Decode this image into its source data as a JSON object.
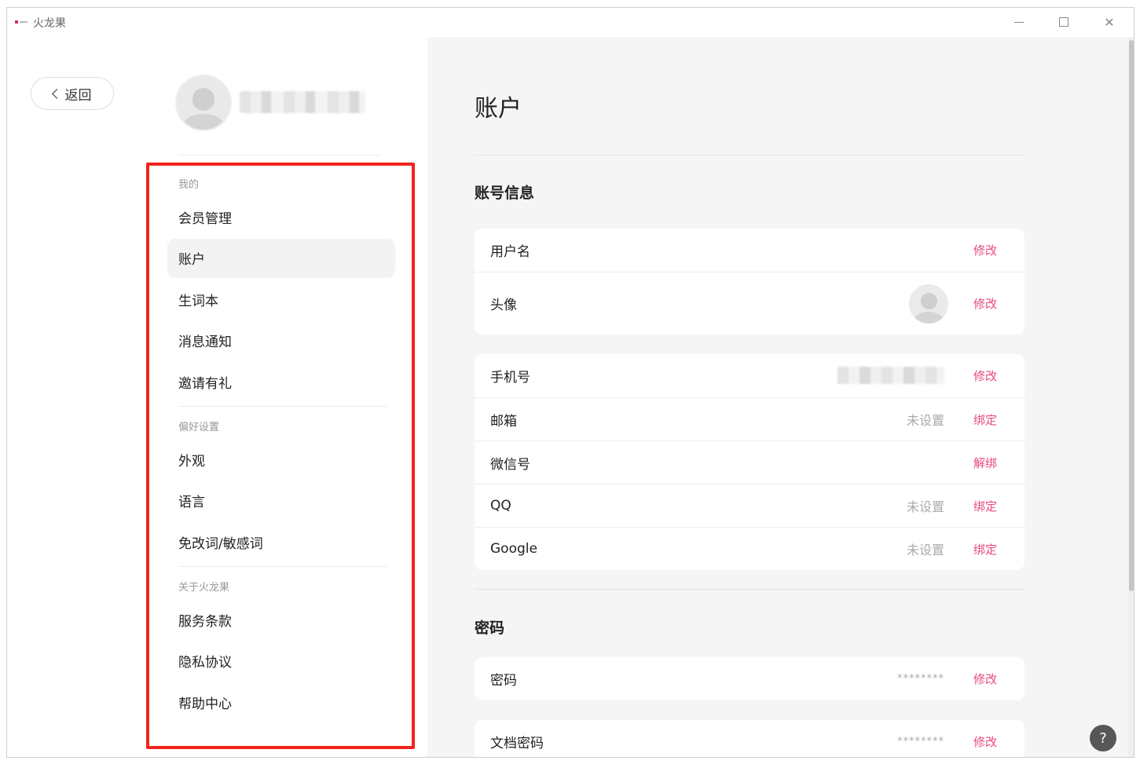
{
  "window": {
    "app_title": "火龙果",
    "close_glyph": "✕"
  },
  "sidebar": {
    "back_label": "返回",
    "sections": [
      {
        "title": "我的",
        "items": [
          {
            "label": "会员管理",
            "active": false
          },
          {
            "label": "账户",
            "active": true
          },
          {
            "label": "生词本",
            "active": false
          },
          {
            "label": "消息通知",
            "active": false
          },
          {
            "label": "邀请有礼",
            "active": false
          }
        ]
      },
      {
        "title": "偏好设置",
        "items": [
          {
            "label": "外观",
            "active": false
          },
          {
            "label": "语言",
            "active": false
          },
          {
            "label": "免改词/敏感词",
            "active": false
          }
        ]
      },
      {
        "title": "关于火龙果",
        "items": [
          {
            "label": "服务条款",
            "active": false
          },
          {
            "label": "隐私协议",
            "active": false
          },
          {
            "label": "帮助中心",
            "active": false
          }
        ]
      }
    ]
  },
  "main": {
    "page_title": "账户",
    "account_info": {
      "title": "账号信息",
      "profile_card": {
        "username": {
          "label": "用户名",
          "action": "修改"
        },
        "avatar": {
          "label": "头像",
          "action": "修改"
        }
      },
      "bindings_card": {
        "phone": {
          "label": "手机号",
          "action": "修改"
        },
        "email": {
          "label": "邮箱",
          "value": "未设置",
          "action": "绑定"
        },
        "wechat": {
          "label": "微信号",
          "action": "解绑"
        },
        "qq": {
          "label": "QQ",
          "value": "未设置",
          "action": "绑定"
        },
        "google": {
          "label": "Google",
          "value": "未设置",
          "action": "绑定"
        }
      }
    },
    "password": {
      "title": "密码",
      "login": {
        "label": "密码",
        "value": "********",
        "action": "修改"
      },
      "document": {
        "label": "文档密码",
        "value": "********",
        "action": "修改"
      }
    }
  },
  "help": {
    "glyph": "?"
  },
  "colors": {
    "accent": "#e84a7f",
    "highlight": "#f2231c",
    "main_bg": "#f5f5f6",
    "active_item_bg": "#f3f3f4"
  }
}
